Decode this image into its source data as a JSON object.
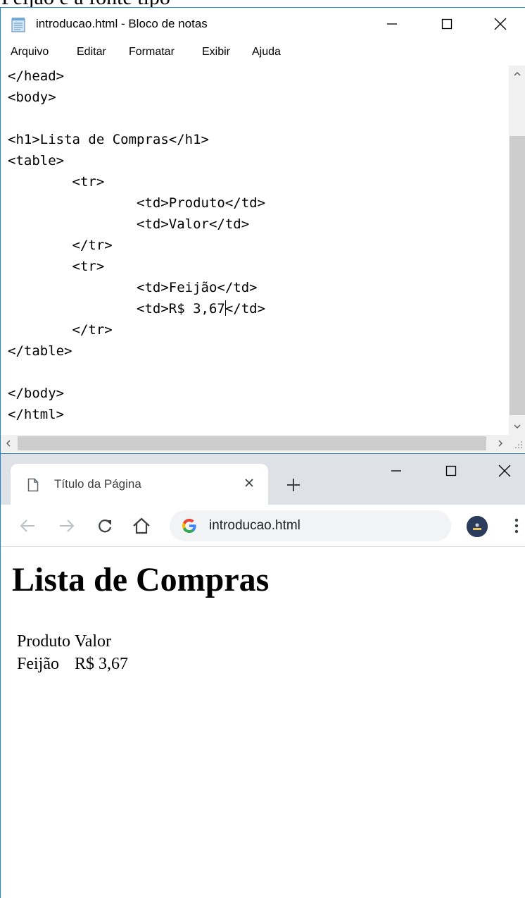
{
  "top_crop_text": "Feijão e a fonte tipo",
  "notepad": {
    "title": "introducao.html - Bloco de notas",
    "menu": [
      "Arquivo",
      "Editar",
      "Formatar",
      "Exibir",
      "Ajuda"
    ],
    "code_lines": [
      "</head>",
      "<body>",
      "",
      "<h1>Lista de Compras</h1>",
      "<table>",
      "        <tr>",
      "                <td>Produto</td>",
      "                <td>Valor</td>",
      "        </tr>",
      "        <tr>",
      "                <td>Feijão</td>",
      "                <td>R$ 3,67",
      "        </tr>",
      "</table>",
      "",
      "</body>",
      "</html>"
    ],
    "caret_line_rest": "</td>"
  },
  "chrome": {
    "tab_title": "Título da Página",
    "url": "introducao.html",
    "page": {
      "heading": "Lista de Compras",
      "table": [
        [
          "Produto",
          "Valor"
        ],
        [
          "Feijão",
          "R$ 3,67"
        ]
      ]
    }
  },
  "colors": {
    "window_border": "#1e88d6",
    "tabstrip_bg": "#dee1e6",
    "omnibox_bg": "#f1f3f4",
    "scrollbar_thumb": "#cdcdcd"
  },
  "icons": [
    "notepad-app-icon",
    "minimize-icon",
    "maximize-icon",
    "close-icon",
    "page-icon",
    "tab-close-icon",
    "new-tab-icon",
    "back-arrow-icon",
    "forward-arrow-icon",
    "reload-icon",
    "home-icon",
    "google-g-icon",
    "profile-avatar-icon",
    "more-menu-icon",
    "scroll-up-icon",
    "scroll-down-icon",
    "scroll-left-icon",
    "scroll-right-icon"
  ]
}
